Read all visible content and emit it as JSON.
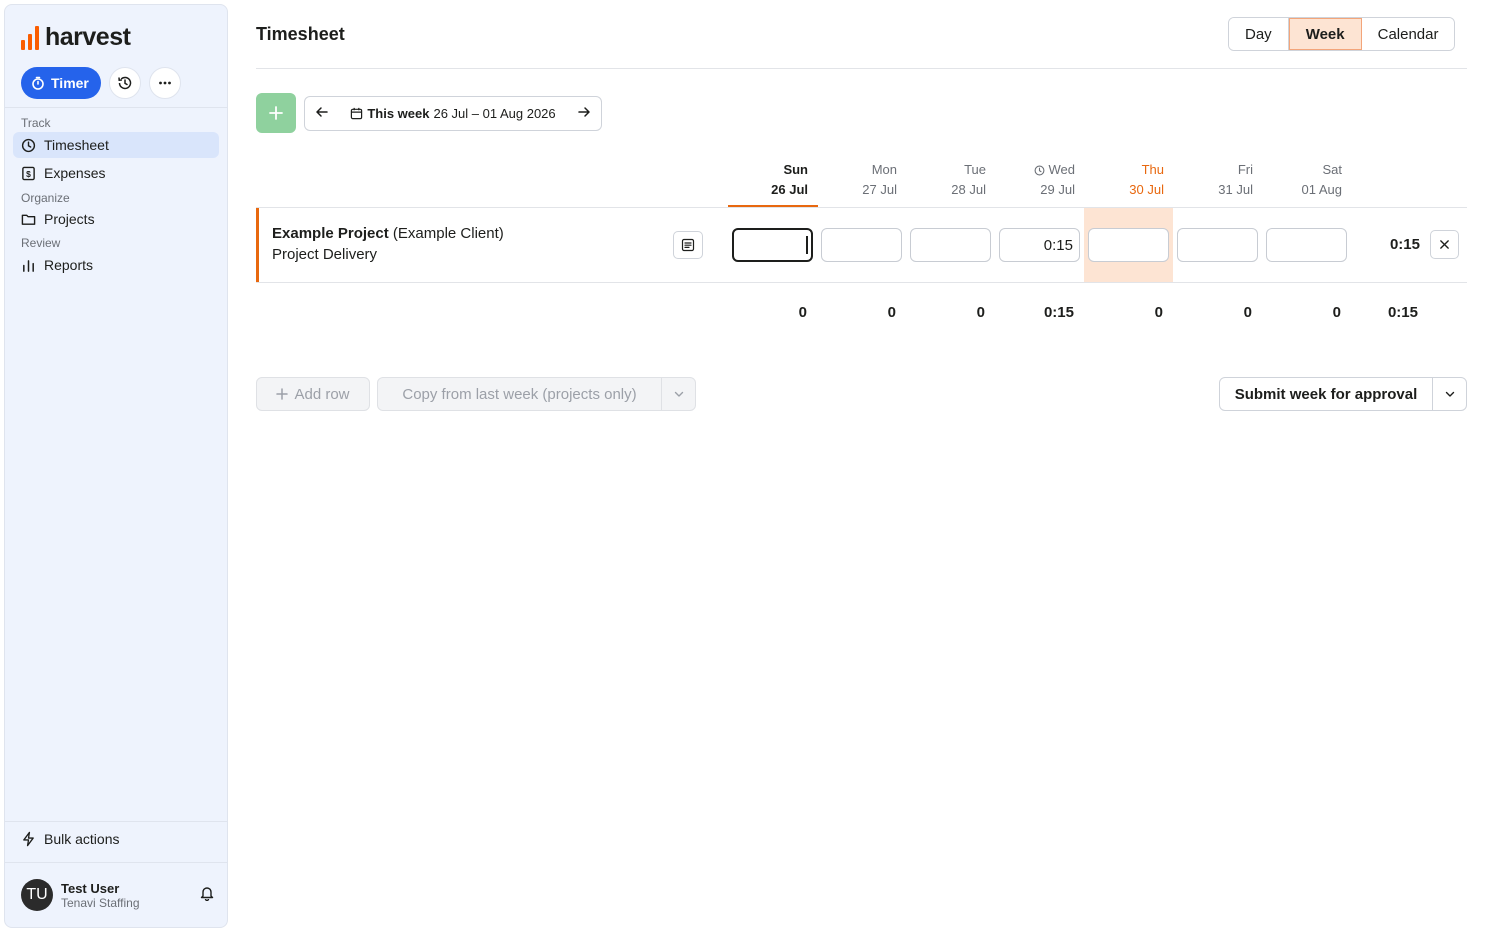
{
  "sidebar": {
    "logo_text": "harvest",
    "timer_label": "Timer",
    "sections": [
      {
        "label": "Track"
      },
      {
        "label": "Organize"
      },
      {
        "label": "Review"
      }
    ],
    "items": [
      {
        "label": "Timesheet",
        "icon": "clock-icon",
        "active": true
      },
      {
        "label": "Expenses",
        "icon": "receipt-icon"
      },
      {
        "label": "Projects",
        "icon": "folder-icon"
      },
      {
        "label": "Reports",
        "icon": "bar-chart-icon"
      }
    ],
    "bulk_actions_label": "Bulk actions",
    "user": {
      "initials": "TU",
      "name": "Test User",
      "org": "Tenavi Staffing"
    }
  },
  "header": {
    "title": "Timesheet",
    "views": [
      {
        "label": "Day"
      },
      {
        "label": "Week",
        "selected": true
      },
      {
        "label": "Calendar"
      }
    ]
  },
  "week_nav": {
    "prefix": "This week",
    "range": "26 Jul – 01 Aug 2026"
  },
  "days": [
    {
      "name": "Sun",
      "date": "26 Jul"
    },
    {
      "name": "Mon",
      "date": "27 Jul"
    },
    {
      "name": "Tue",
      "date": "28 Jul"
    },
    {
      "name": "Wed",
      "date": "29 Jul"
    },
    {
      "name": "Thu",
      "date": "30 Jul"
    },
    {
      "name": "Fri",
      "date": "31 Jul"
    },
    {
      "name": "Sat",
      "date": "01 Aug"
    }
  ],
  "row": {
    "project": "Example Project",
    "client": "(Example Client)",
    "task": "Project Delivery",
    "values": [
      "",
      "",
      "",
      "0:15",
      "",
      "",
      ""
    ],
    "total": "0:15"
  },
  "totals": {
    "values": [
      "0",
      "0",
      "0",
      "0:15",
      "0",
      "0",
      "0"
    ],
    "grand_total": "0:15"
  },
  "actions": {
    "add_row": "Add row",
    "copy_last_week": "Copy from last week (projects only)",
    "submit": "Submit week for approval"
  },
  "colors": {
    "accent": "#e8680f",
    "timer_blue": "#2563eb",
    "add_green": "#8fd19e",
    "today_bg": "#fde4d3"
  }
}
